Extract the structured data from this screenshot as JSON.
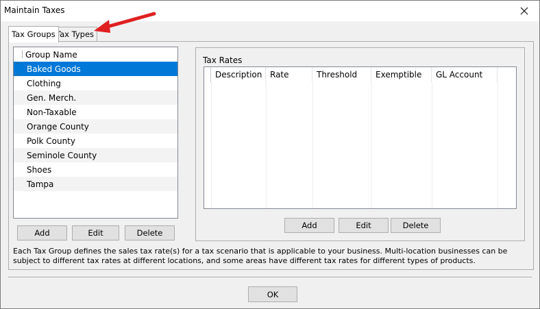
{
  "window": {
    "title": "Maintain Taxes"
  },
  "tabs": [
    {
      "label": "Tax Groups",
      "active": true
    },
    {
      "label": "Tax Types",
      "active": false
    }
  ],
  "groups": {
    "header": "Group Name",
    "items": [
      {
        "label": "Baked Goods",
        "selected": true
      },
      {
        "label": "Clothing"
      },
      {
        "label": "Gen. Merch."
      },
      {
        "label": "Non-Taxable"
      },
      {
        "label": "Orange County"
      },
      {
        "label": "Polk County"
      },
      {
        "label": "Seminole County"
      },
      {
        "label": "Shoes"
      },
      {
        "label": "Tampa"
      }
    ],
    "buttons": {
      "add": "Add",
      "edit": "Edit",
      "delete": "Delete"
    }
  },
  "tax_rates": {
    "title": "Tax Rates",
    "columns": [
      "Description",
      "Rate",
      "Threshold",
      "Exemptible",
      "GL Account"
    ],
    "buttons": {
      "add": "Add",
      "edit": "Edit",
      "delete": "Delete"
    }
  },
  "description": "Each Tax Group defines the sales tax rate(s) for a tax scenario that is applicable to your business. Multi-location businesses can be subject to different tax rates at different locations, and some areas have different tax rates for different types of products.",
  "footer": {
    "ok": "OK"
  },
  "colors": {
    "selection": "#0078d7",
    "annotation_arrow": "#e02020",
    "button_face": "#e1e1e1",
    "window_bg": "#f0f0f0"
  },
  "icons": {
    "close": "close-icon",
    "annotation": "red-arrow-annotation"
  }
}
